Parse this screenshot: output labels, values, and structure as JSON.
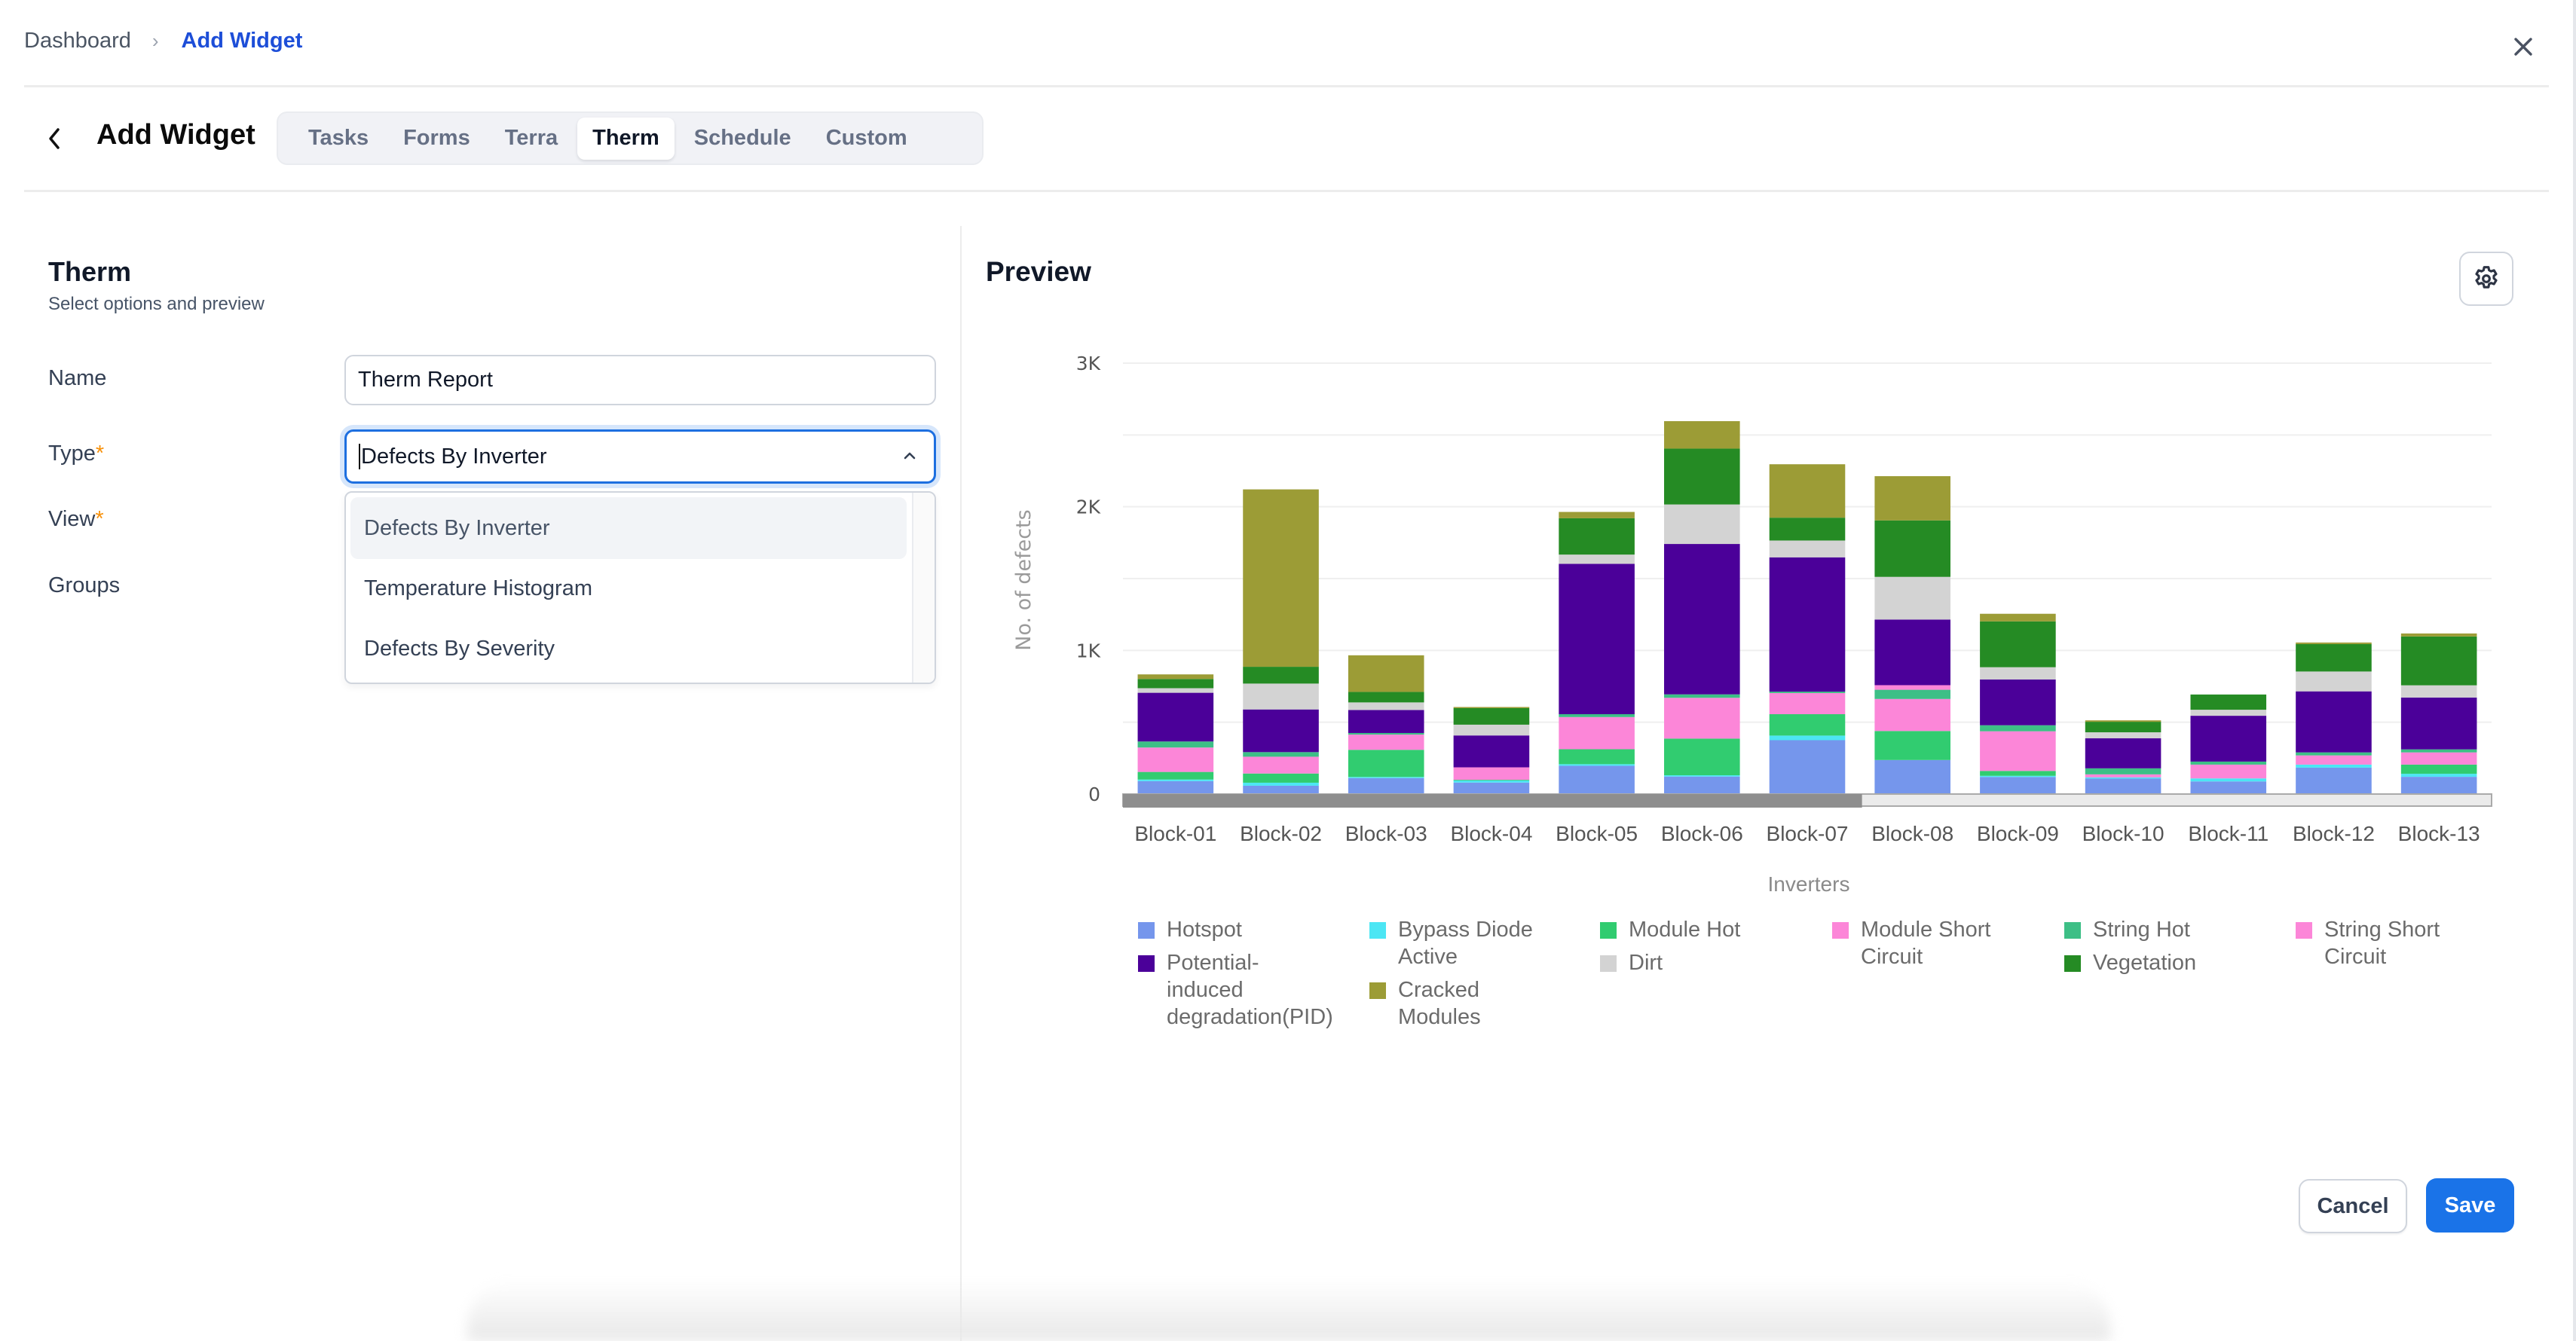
{
  "breadcrumb": {
    "home": "Dashboard",
    "separator": "›",
    "current": "Add Widget"
  },
  "header": {
    "title": "Add Widget",
    "back_icon": "chevron-left-icon",
    "close_icon": "close-icon"
  },
  "tabs": [
    {
      "label": "Tasks",
      "active": false
    },
    {
      "label": "Forms",
      "active": false
    },
    {
      "label": "Terra",
      "active": false
    },
    {
      "label": "Therm",
      "active": true
    },
    {
      "label": "Schedule",
      "active": false
    },
    {
      "label": "Custom",
      "active": false
    }
  ],
  "form": {
    "title": "Therm",
    "subtitle": "Select options and preview",
    "required_mark": "*",
    "name": {
      "label": "Name",
      "value": "Therm Report"
    },
    "type": {
      "label": "Type",
      "value": "Defects By Inverter",
      "open": true,
      "options": [
        "Defects By Inverter",
        "Temperature Histogram",
        "Defects By Severity"
      ],
      "highlighted_index": 0
    },
    "view": {
      "label": "View"
    },
    "groups": {
      "label": "Groups"
    }
  },
  "preview": {
    "title": "Preview",
    "settings_icon": "gear-icon"
  },
  "actions": {
    "cancel": "Cancel",
    "save": "Save"
  },
  "colors": {
    "accent": "#1a73e8",
    "link": "#1d4ed8",
    "required": "#f79009"
  },
  "chart_data": {
    "type": "bar",
    "stacked": true,
    "title": "",
    "xlabel": "Inverters",
    "ylabel": "No. of defects",
    "ylim": [
      0,
      3000
    ],
    "yticks": [
      0,
      1000,
      2000,
      3000
    ],
    "ytick_labels": [
      "0",
      "1K",
      "2K",
      "3K"
    ],
    "grid_step": 500,
    "grid": true,
    "legend_position": "bottom",
    "data_zoom_visible_fraction": 0.54,
    "categories": [
      "Block-01",
      "Block-02",
      "Block-03",
      "Block-04",
      "Block-05",
      "Block-06",
      "Block-07",
      "Block-08",
      "Block-09",
      "Block-10",
      "Block-11",
      "Block-12",
      "Block-13"
    ],
    "series": [
      {
        "name": "Hotspot",
        "color": "#7596ec",
        "values": [
          90,
          58,
          111,
          80,
          197,
          122,
          375,
          237,
          119,
          108,
          88,
          184,
          120
        ]
      },
      {
        "name": "Bypass Diode Active",
        "color": "#4ce6f4",
        "values": [
          11,
          21,
          8,
          15,
          11,
          9,
          32,
          0,
          8,
          8,
          21,
          21,
          21
        ]
      },
      {
        "name": "Module Hot",
        "color": "#31cc70",
        "values": [
          53,
          64,
          189,
          4,
          104,
          255,
          149,
          202,
          34,
          0,
          0,
          0,
          64
        ]
      },
      {
        "name": "Module Short Circuit",
        "color": "#fc86d8",
        "values": [
          170,
          117,
          106,
          87,
          224,
          284,
          147,
          223,
          276,
          21,
          96,
          64,
          85
        ]
      },
      {
        "name": "String Hot",
        "color": "#3dbf86",
        "values": [
          42,
          32,
          11,
          0,
          20,
          24,
          10,
          64,
          42,
          42,
          21,
          21,
          21
        ]
      },
      {
        "name": "String Short Circuit",
        "color": "#fc86d8",
        "values": [
          0,
          0,
          0,
          0,
          0,
          0,
          0,
          32,
          0,
          0,
          0,
          0,
          0
        ]
      },
      {
        "name": "Potential-induced degradation(PID)",
        "color": "#4b0099",
        "values": [
          339,
          297,
          160,
          222,
          1047,
          1047,
          935,
          457,
          319,
          209,
          319,
          425,
          361
        ]
      },
      {
        "name": "Dirt",
        "color": "#d3d3d3",
        "values": [
          32,
          180,
          53,
          75,
          64,
          275,
          117,
          297,
          85,
          42,
          42,
          138,
          85
        ]
      },
      {
        "name": "Vegetation",
        "color": "#258b24",
        "values": [
          64,
          117,
          73,
          115,
          253,
          389,
          159,
          393,
          319,
          73,
          106,
          191,
          340
        ]
      },
      {
        "name": "Cracked Modules",
        "color": "#9c9c36",
        "values": [
          32,
          1235,
          255,
          8,
          44,
          191,
          372,
          308,
          53,
          10,
          0,
          11,
          21
        ]
      }
    ]
  }
}
